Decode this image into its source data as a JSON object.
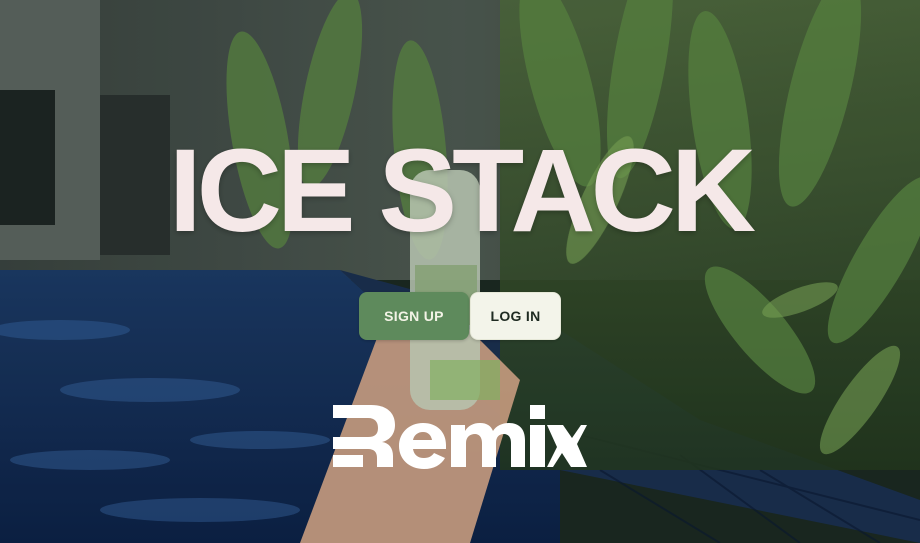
{
  "hero": {
    "title": "ICE STACK",
    "background_image": "pool-and-plants-with-bottle-photo"
  },
  "actions": {
    "signup_label": "SIGN UP",
    "login_label": "LOG IN"
  },
  "footer": {
    "logo_text": "Remix"
  },
  "colors": {
    "title_text": "#f5e8e8",
    "signup_bg": "#5e8a5c",
    "signup_text": "#f3f3e6",
    "login_bg": "#f3f4ea",
    "login_text": "#1f2b22",
    "logo_white": "#ffffff"
  }
}
